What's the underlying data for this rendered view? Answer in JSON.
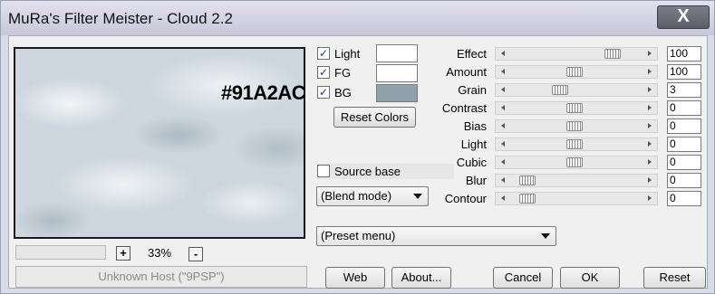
{
  "window": {
    "title": "MuRa's Filter Meister - Cloud 2.2",
    "close_label": "X"
  },
  "preview": {
    "overlay_text": "#91A2AC"
  },
  "zoom": {
    "plus": "+",
    "minus": "-",
    "value": "33%"
  },
  "status": "Unknown Host (\"9PSP\")",
  "colors": [
    {
      "label": "Light",
      "checked": true,
      "swatch": "#ffffff"
    },
    {
      "label": "FG",
      "checked": true,
      "swatch": "#ffffff"
    },
    {
      "label": "BG",
      "checked": true,
      "swatch": "#91a2ac"
    }
  ],
  "reset_colors_label": "Reset Colors",
  "source_base": {
    "label": "Source base",
    "checked": false
  },
  "blend_mode": {
    "selected": "(Blend mode)"
  },
  "preset_menu": {
    "selected": "(Preset menu)"
  },
  "params": [
    {
      "label": "Effect",
      "value": "100"
    },
    {
      "label": "Amount",
      "value": "100"
    },
    {
      "label": "Grain",
      "value": "3"
    },
    {
      "label": "Contrast",
      "value": "0"
    },
    {
      "label": "Bias",
      "value": "0"
    },
    {
      "label": "Light",
      "value": "0"
    },
    {
      "label": "Cubic",
      "value": "0"
    },
    {
      "label": "Blur",
      "value": "0"
    },
    {
      "label": "Contour",
      "value": "0"
    }
  ],
  "slider_positions": [
    0.8,
    0.48,
    0.35,
    0.48,
    0.48,
    0.48,
    0.48,
    0.08,
    0.08
  ],
  "buttons": {
    "web": "Web",
    "about": "About...",
    "cancel": "Cancel",
    "ok": "OK",
    "reset": "Reset"
  },
  "check_glyph": "✓"
}
